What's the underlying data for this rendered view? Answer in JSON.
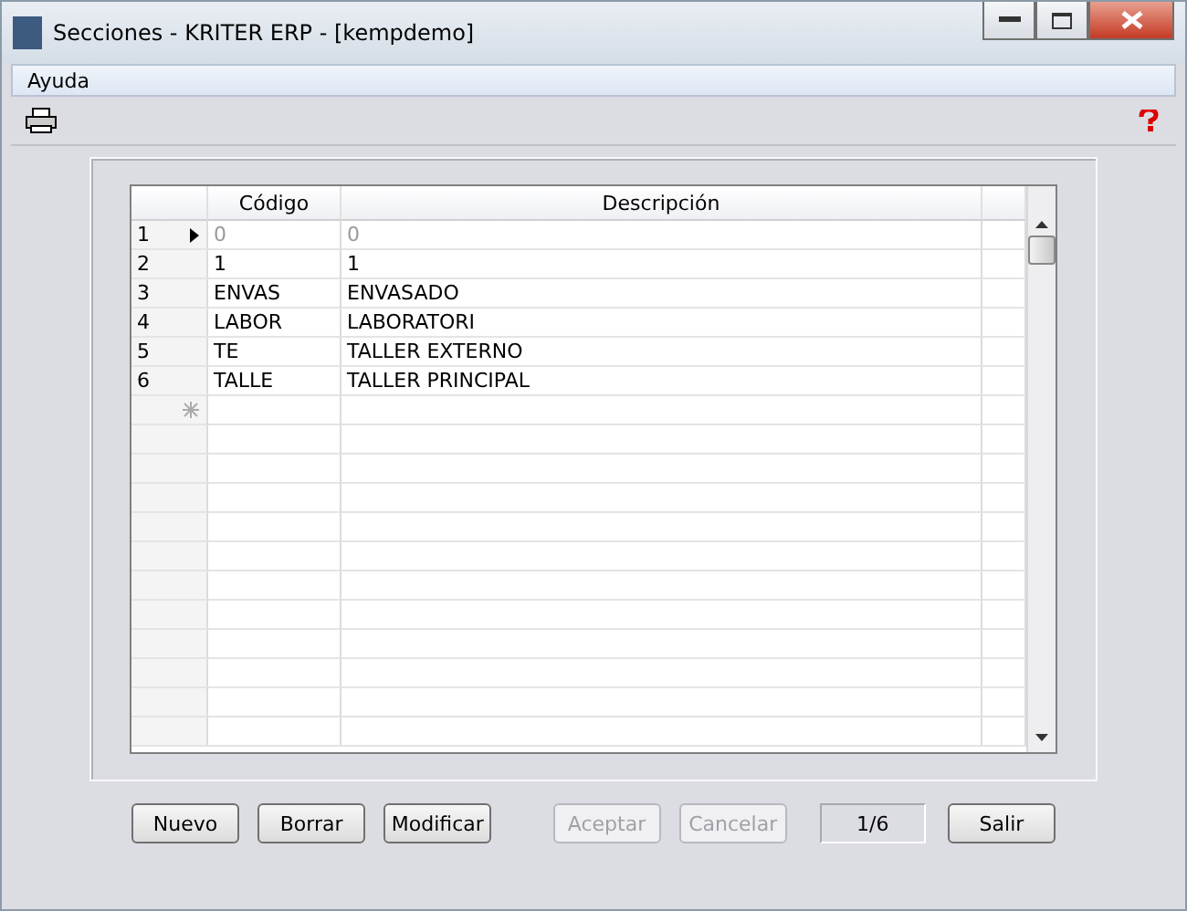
{
  "window": {
    "title": "Secciones - KRITER ERP - [kempdemo]"
  },
  "menu": [
    "Ayuda"
  ],
  "table": {
    "columns": [
      "Código",
      "Descripción"
    ],
    "rows": [
      {
        "number": "1",
        "cells": [
          "0",
          "0"
        ],
        "selected": true
      },
      {
        "number": "2",
        "cells": [
          "1",
          "1"
        ],
        "selected": false
      },
      {
        "number": "3",
        "cells": [
          "ENVAS",
          "ENVASADO"
        ],
        "selected": false
      },
      {
        "number": "4",
        "cells": [
          "LABOR",
          "LABORATORI"
        ],
        "selected": false
      },
      {
        "number": "5",
        "cells": [
          "TE",
          "TALLER EXTERNO"
        ],
        "selected": false
      },
      {
        "number": "6",
        "cells": [
          "TALLE",
          "TALLER PRINCIPAL"
        ],
        "selected": false
      }
    ]
  },
  "buttons": [
    {
      "label": "Nuevo",
      "disabled": false
    },
    {
      "label": "Borrar",
      "disabled": false
    },
    {
      "label": "Modificar",
      "disabled": false
    },
    {
      "label": "Aceptar",
      "disabled": true
    },
    {
      "label": "Cancelar",
      "disabled": true
    }
  ],
  "record_counter": "1/6",
  "exit_button": {
    "label": "Salir"
  }
}
